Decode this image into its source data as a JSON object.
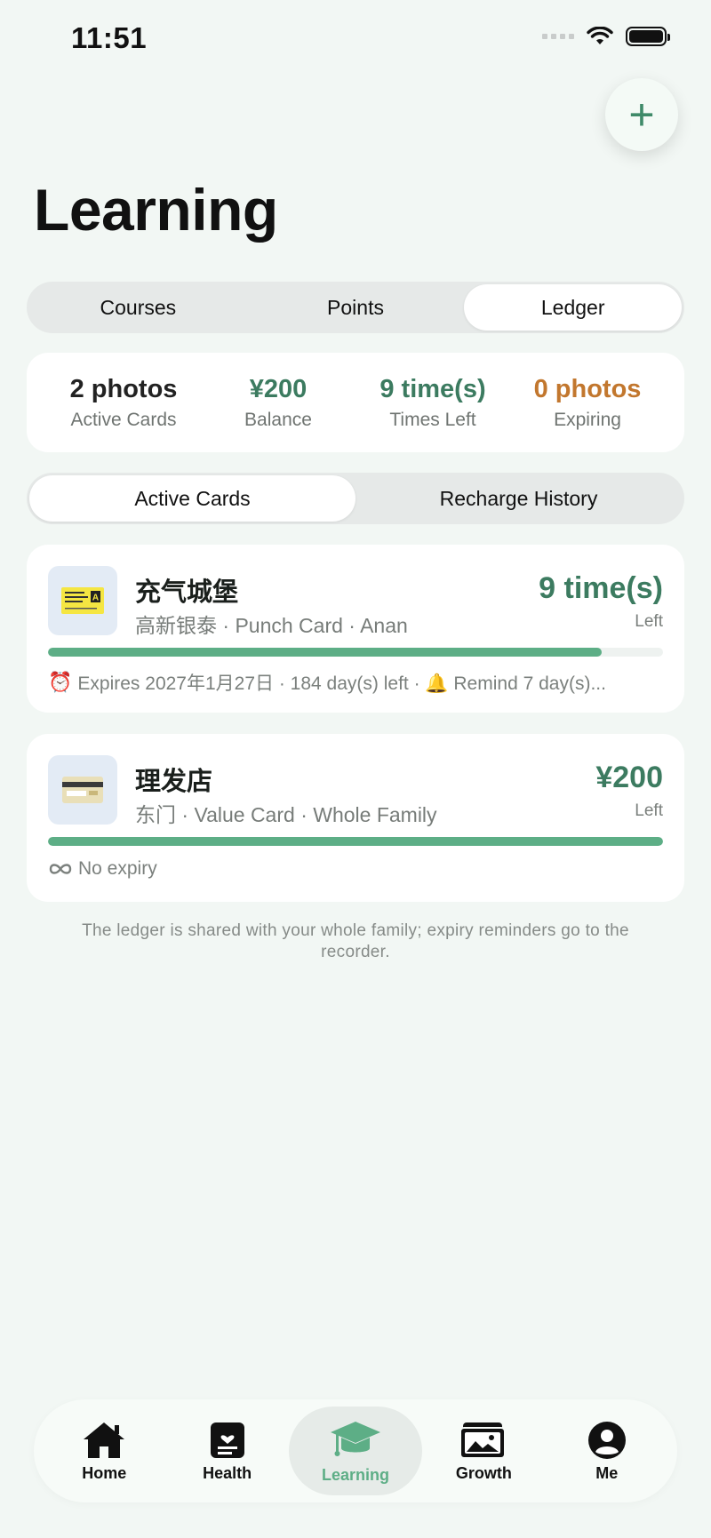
{
  "status_bar": {
    "time": "11:51"
  },
  "page": {
    "title": "Learning",
    "fab_label": "+"
  },
  "tabs_top": [
    {
      "label": "Courses",
      "active": false
    },
    {
      "label": "Points",
      "active": false
    },
    {
      "label": "Ledger",
      "active": true
    }
  ],
  "stats": [
    {
      "value": "2 photos",
      "label": "Active Cards",
      "color": "#222222"
    },
    {
      "value": "¥200",
      "label": "Balance",
      "color": "#3C7B60"
    },
    {
      "value": "9 time(s)",
      "label": "Times Left",
      "color": "#3C7B60"
    },
    {
      "value": "0 photos",
      "label": "Expiring",
      "color": "#C2772E"
    }
  ],
  "subtabs": [
    {
      "label": "Active Cards",
      "active": true
    },
    {
      "label": "Recharge History",
      "active": false
    }
  ],
  "cards": [
    {
      "name": "充气城堡",
      "subtitle": "高新银泰 · Punch Card · Anan",
      "amount": "9 time(s)",
      "amount_suffix": "Left",
      "progress": 0.9,
      "footer_icon": "alarm-clock-icon",
      "footer_text": "Expires 2027年1月27日 · 184 day(s) left · 🔔 Remind 7 day(s)..."
    },
    {
      "name": "理发店",
      "subtitle": "东门 · Value Card · Whole Family",
      "amount": "¥200",
      "amount_suffix": "Left",
      "progress": 1.0,
      "footer_icon": "infinity-icon",
      "footer_text": "No expiry"
    }
  ],
  "footnote": "The ledger is shared with your whole family; expiry reminders go to the recorder.",
  "bottom_nav": [
    {
      "label": "Home",
      "icon": "home-icon",
      "active": false
    },
    {
      "label": "Health",
      "icon": "health-icon",
      "active": false
    },
    {
      "label": "Learning",
      "icon": "graduation-cap-icon",
      "active": true
    },
    {
      "label": "Growth",
      "icon": "photos-icon",
      "active": false
    },
    {
      "label": "Me",
      "icon": "person-icon",
      "active": false
    }
  ],
  "colors": {
    "accent": "#3C7B60",
    "progress": "#5DAE86",
    "warning": "#C2772E",
    "background": "#F2F7F4"
  }
}
